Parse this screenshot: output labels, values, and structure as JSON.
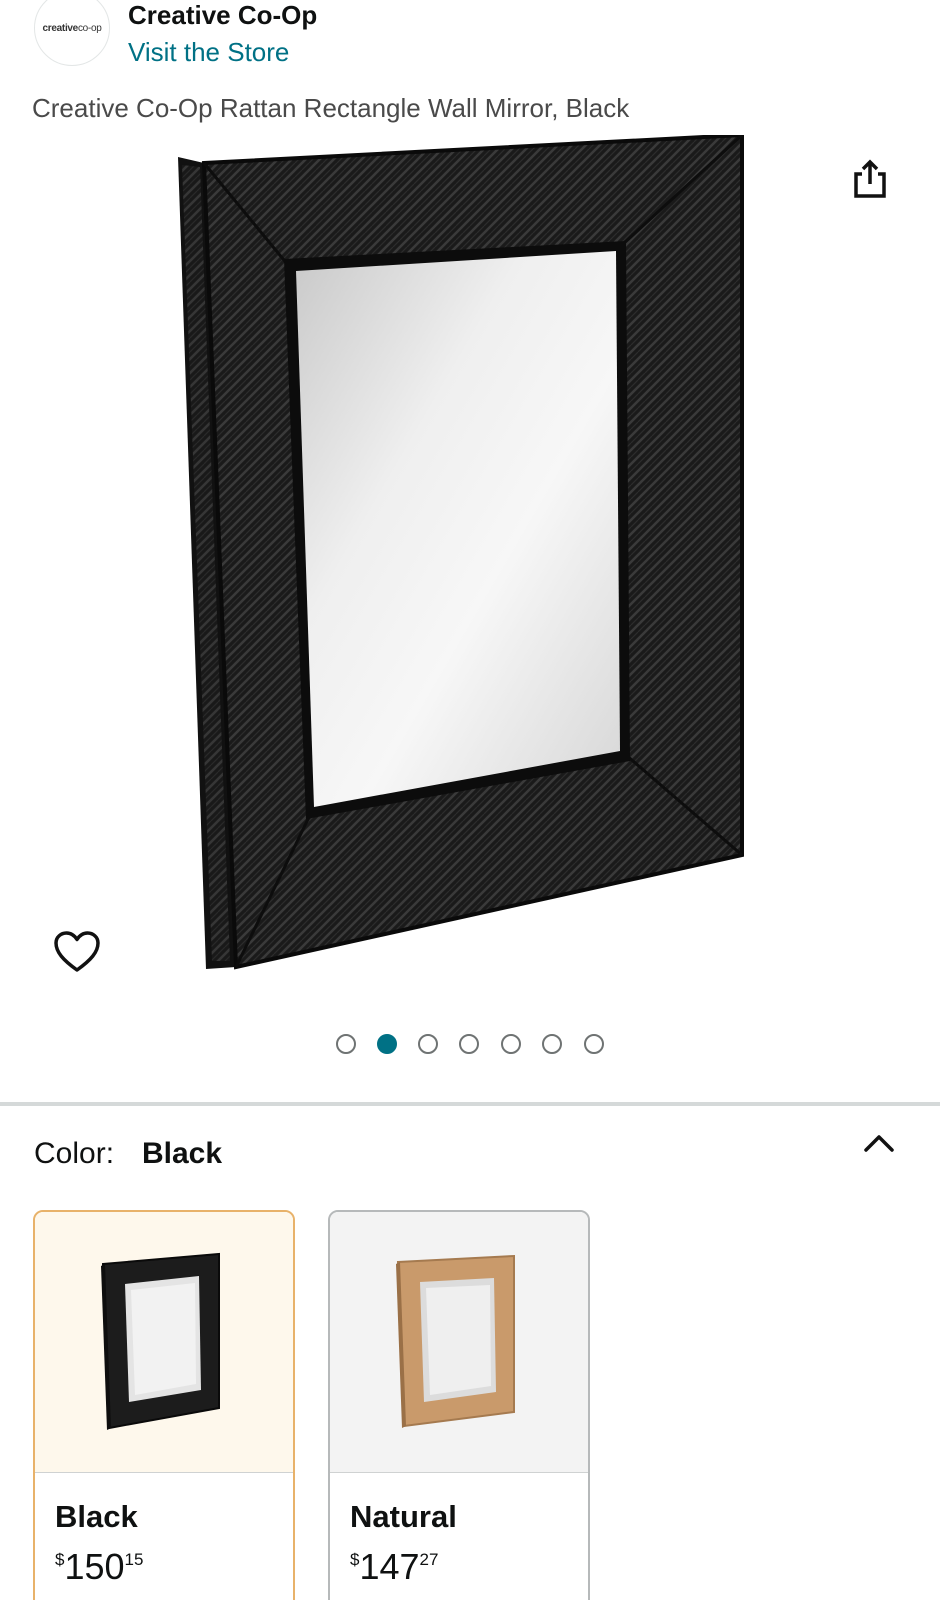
{
  "brand": {
    "logo_text_bold": "creative",
    "logo_text_light": "co-op",
    "name": "Creative Co-Op",
    "store_link": "Visit the Store"
  },
  "product": {
    "title": "Creative Co-Op Rattan Rectangle Wall Mirror, Black"
  },
  "icons": {
    "share": "share-icon",
    "wishlist": "heart-icon",
    "collapse": "chevron-up-icon"
  },
  "carousel": {
    "count": 7,
    "active_index": 1
  },
  "colors": {
    "accent": "#007185",
    "selected_border": "#e8b26a"
  },
  "color_section": {
    "label": "Color:",
    "selected": "Black",
    "options": [
      {
        "name": "Black",
        "price_symbol": "$",
        "price_whole": "150",
        "price_fraction": "15"
      },
      {
        "name": "Natural",
        "price_symbol": "$",
        "price_whole": "147",
        "price_fraction": "27"
      }
    ]
  }
}
